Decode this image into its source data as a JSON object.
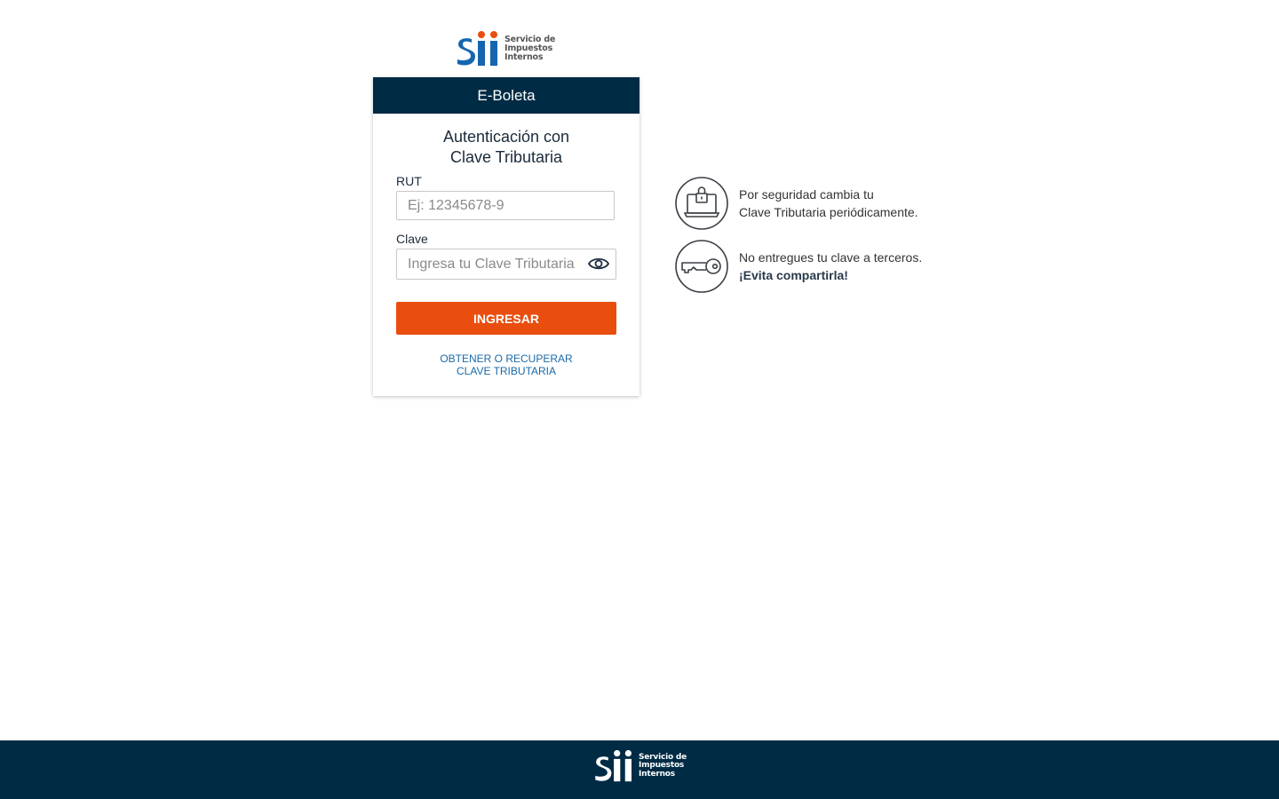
{
  "brand": {
    "logo_text_lines": [
      "Servicio de",
      "Impuestos",
      "Internos"
    ],
    "colors": {
      "navy": "#002b45",
      "orange": "#e94e0f",
      "blue": "#1a6aa8",
      "logo_blue": "#1565b0",
      "logo_orange": "#e94e0f"
    }
  },
  "card": {
    "header": "E-Boleta",
    "title_line1": "Autenticación con",
    "title_line2": "Clave Tributaria",
    "rut_label": "RUT",
    "rut_placeholder": "Ej: 12345678-9",
    "clave_label": "Clave",
    "clave_placeholder": "Ingresa tu Clave Tributaria",
    "submit_label": "INGRESAR",
    "recover_line1": "OBTENER O RECUPERAR",
    "recover_line2": "CLAVE TRIBUTARIA"
  },
  "tips": [
    {
      "icon": "laptop-lock-icon",
      "line1": "Por seguridad cambia tu",
      "line2": "Clave Tributaria periódicamente."
    },
    {
      "icon": "key-icon",
      "line1": "No entregues tu clave a terceros.",
      "line2": "¡Evita compartirla!"
    }
  ],
  "footer": {
    "logo_text_lines": [
      "Servicio de",
      "Impuestos",
      "Internos"
    ]
  }
}
